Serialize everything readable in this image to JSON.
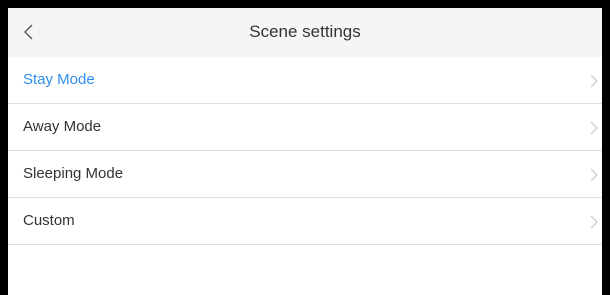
{
  "header": {
    "back_icon": "chevron-left-icon",
    "title": "Scene settings"
  },
  "colors": {
    "active_text": "#2e8ff0",
    "header_background": "#f5f5f5",
    "divider": "#dedede",
    "frame_border": "#000000"
  },
  "scenes": {
    "items": [
      {
        "label": "Stay Mode",
        "selected": true,
        "icon": "chevron-right-icon"
      },
      {
        "label": "Away Mode",
        "selected": false,
        "icon": "chevron-right-icon"
      },
      {
        "label": "Sleeping Mode",
        "selected": false,
        "icon": "chevron-right-icon"
      },
      {
        "label": "Custom",
        "selected": false,
        "icon": "chevron-right-icon"
      }
    ]
  }
}
